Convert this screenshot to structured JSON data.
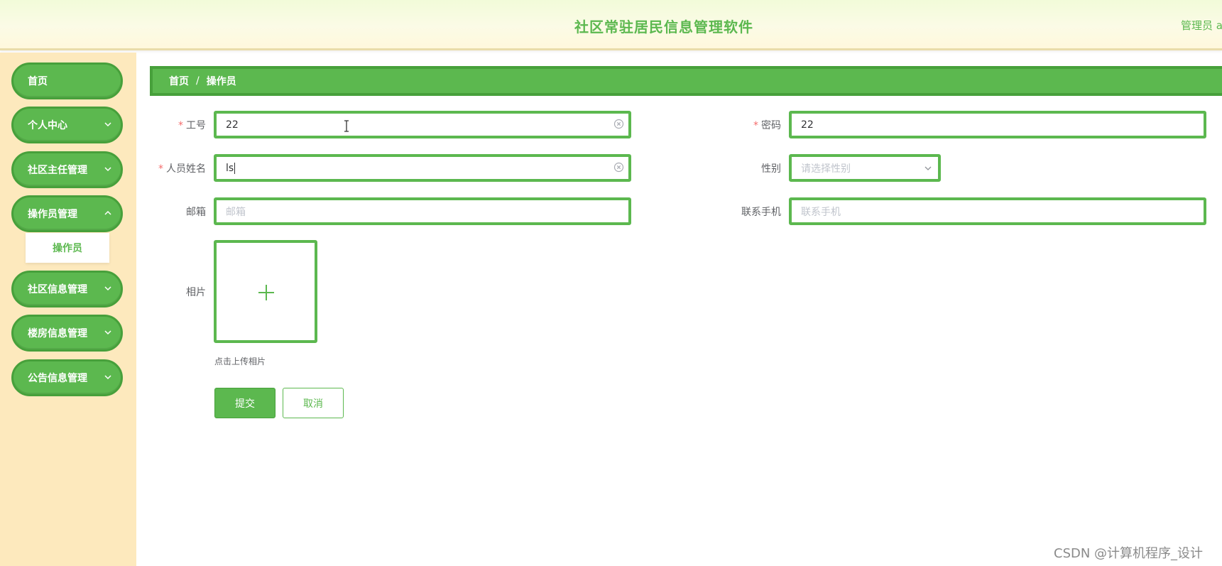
{
  "header": {
    "title": "社区常驻居民信息管理软件",
    "user": "管理员 a"
  },
  "sidebar": {
    "items": [
      {
        "label": "首页",
        "has_chevron": false
      },
      {
        "label": "个人中心",
        "has_chevron": true
      },
      {
        "label": "社区主任管理",
        "has_chevron": true
      },
      {
        "label": "操作员管理",
        "has_chevron": true,
        "expanded": true,
        "children": [
          {
            "label": "操作员"
          }
        ]
      },
      {
        "label": "社区信息管理",
        "has_chevron": true
      },
      {
        "label": "楼房信息管理",
        "has_chevron": true
      },
      {
        "label": "公告信息管理",
        "has_chevron": true
      }
    ]
  },
  "breadcrumb": {
    "home": "首页",
    "separator": "/",
    "current": "操作员"
  },
  "form": {
    "required_mark": "*",
    "employee_id": {
      "label": "工号",
      "value": "22",
      "required": true
    },
    "password": {
      "label": "密码",
      "value": "22",
      "required": true
    },
    "name": {
      "label": "人员姓名",
      "value": "ls",
      "required": true
    },
    "gender": {
      "label": "性别",
      "placeholder": "请选择性别"
    },
    "email": {
      "label": "邮箱",
      "placeholder": "邮箱"
    },
    "phone": {
      "label": "联系手机",
      "placeholder": "联系手机"
    },
    "photo": {
      "label": "相片",
      "hint": "点击上传相片"
    },
    "submit_label": "提交",
    "cancel_label": "取消"
  },
  "watermark": "CSDN @计算机程序_设计",
  "colors": {
    "accent": "#5cb84f",
    "accent_dark": "#47a03b",
    "sidebar_bg": "#fde9bd",
    "required": "#f56c6c"
  },
  "icons": [
    "chevron-down-icon",
    "clear-icon",
    "plus-icon",
    "text-cursor-icon"
  ]
}
